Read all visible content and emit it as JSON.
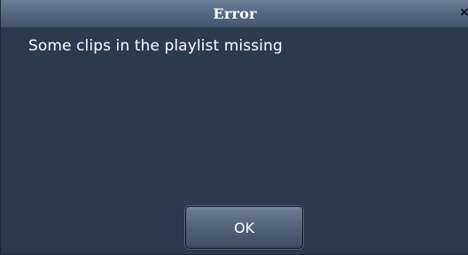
{
  "dialog": {
    "title": "Error",
    "close_icon": "close-icon",
    "close_glyph": "×",
    "message": "Some clips in the playlist missing",
    "ok_label": "OK"
  },
  "colors": {
    "background": "#2c3a4f",
    "titlebar": "#566985",
    "text": "#ffffff"
  }
}
